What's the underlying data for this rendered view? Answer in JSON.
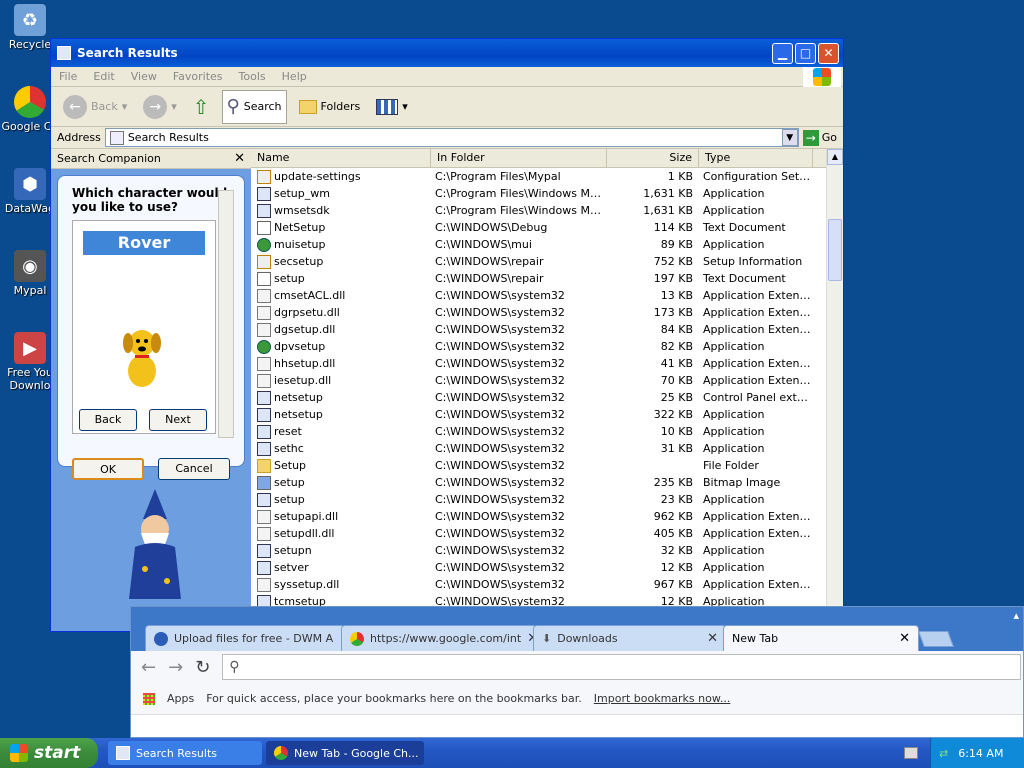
{
  "desktop": {
    "icons": [
      {
        "label": "Recycle",
        "icon": "recycle-bin-icon",
        "color": "#6fa0d8"
      },
      {
        "label": "Google Ch",
        "icon": "chrome-icon",
        "color": "#d33"
      },
      {
        "label": "DataWag",
        "icon": "datawag-icon",
        "color": "#3568b8"
      },
      {
        "label": "Mypal",
        "icon": "mypal-icon",
        "color": "#555"
      },
      {
        "label": "Free You",
        "label2": "Downlo",
        "icon": "freeyoutube-icon",
        "color": "#c44"
      }
    ]
  },
  "explorer": {
    "title": "Search Results",
    "menu": [
      "File",
      "Edit",
      "View",
      "Favorites",
      "Tools",
      "Help"
    ],
    "toolbar": {
      "back": "Back",
      "search": "Search",
      "folders": "Folders"
    },
    "address_label": "Address",
    "address_value": "Search Results",
    "go_label": "Go",
    "companion": {
      "title": "Search Companion",
      "question": "Which character would you like to use?",
      "character": "Rover",
      "back": "Back",
      "next": "Next",
      "ok": "OK",
      "cancel": "Cancel"
    },
    "columns": [
      "Name",
      "In Folder",
      "Size",
      "Type"
    ],
    "rows": [
      {
        "name": "update-settings",
        "folder": "C:\\Program Files\\Mypal",
        "size": "1 KB",
        "type": "Configuration Settings",
        "icon": "gear"
      },
      {
        "name": "setup_wm",
        "folder": "C:\\Program Files\\Windows Medi...",
        "size": "1,631 KB",
        "type": "Application",
        "icon": "app"
      },
      {
        "name": "wmsetsdk",
        "folder": "C:\\Program Files\\Windows Medi...",
        "size": "1,631 KB",
        "type": "Application",
        "icon": "app"
      },
      {
        "name": "NetSetup",
        "folder": "C:\\WINDOWS\\Debug",
        "size": "114 KB",
        "type": "Text Document",
        "icon": "txt"
      },
      {
        "name": "muisetup",
        "folder": "C:\\WINDOWS\\mui",
        "size": "89 KB",
        "type": "Application",
        "icon": "globe"
      },
      {
        "name": "secsetup",
        "folder": "C:\\WINDOWS\\repair",
        "size": "752 KB",
        "type": "Setup Information",
        "icon": "gear"
      },
      {
        "name": "setup",
        "folder": "C:\\WINDOWS\\repair",
        "size": "197 KB",
        "type": "Text Document",
        "icon": "txt"
      },
      {
        "name": "cmsetACL.dll",
        "folder": "C:\\WINDOWS\\system32",
        "size": "13 KB",
        "type": "Application Extension",
        "icon": "dll"
      },
      {
        "name": "dgrpsetu.dll",
        "folder": "C:\\WINDOWS\\system32",
        "size": "173 KB",
        "type": "Application Extension",
        "icon": "dll"
      },
      {
        "name": "dgsetup.dll",
        "folder": "C:\\WINDOWS\\system32",
        "size": "84 KB",
        "type": "Application Extension",
        "icon": "dll"
      },
      {
        "name": "dpvsetup",
        "folder": "C:\\WINDOWS\\system32",
        "size": "82 KB",
        "type": "Application",
        "icon": "globe"
      },
      {
        "name": "hhsetup.dll",
        "folder": "C:\\WINDOWS\\system32",
        "size": "41 KB",
        "type": "Application Extension",
        "icon": "dll"
      },
      {
        "name": "iesetup.dll",
        "folder": "C:\\WINDOWS\\system32",
        "size": "70 KB",
        "type": "Application Extension",
        "icon": "dll"
      },
      {
        "name": "netsetup",
        "folder": "C:\\WINDOWS\\system32",
        "size": "25 KB",
        "type": "Control Panel exten...",
        "icon": "app"
      },
      {
        "name": "netsetup",
        "folder": "C:\\WINDOWS\\system32",
        "size": "322 KB",
        "type": "Application",
        "icon": "app"
      },
      {
        "name": "reset",
        "folder": "C:\\WINDOWS\\system32",
        "size": "10 KB",
        "type": "Application",
        "icon": "app"
      },
      {
        "name": "sethc",
        "folder": "C:\\WINDOWS\\system32",
        "size": "31 KB",
        "type": "Application",
        "icon": "app"
      },
      {
        "name": "Setup",
        "folder": "C:\\WINDOWS\\system32",
        "size": "",
        "type": "File Folder",
        "icon": "folder"
      },
      {
        "name": "setup",
        "folder": "C:\\WINDOWS\\system32",
        "size": "235 KB",
        "type": "Bitmap Image",
        "icon": "img"
      },
      {
        "name": "setup",
        "folder": "C:\\WINDOWS\\system32",
        "size": "23 KB",
        "type": "Application",
        "icon": "app"
      },
      {
        "name": "setupapi.dll",
        "folder": "C:\\WINDOWS\\system32",
        "size": "962 KB",
        "type": "Application Extension",
        "icon": "dll"
      },
      {
        "name": "setupdll.dll",
        "folder": "C:\\WINDOWS\\system32",
        "size": "405 KB",
        "type": "Application Extension",
        "icon": "dll"
      },
      {
        "name": "setupn",
        "folder": "C:\\WINDOWS\\system32",
        "size": "32 KB",
        "type": "Application",
        "icon": "app"
      },
      {
        "name": "setver",
        "folder": "C:\\WINDOWS\\system32",
        "size": "12 KB",
        "type": "Application",
        "icon": "app"
      },
      {
        "name": "syssetup.dll",
        "folder": "C:\\WINDOWS\\system32",
        "size": "967 KB",
        "type": "Application Extension",
        "icon": "dll"
      },
      {
        "name": "tcmsetup",
        "folder": "C:\\WINDOWS\\system32",
        "size": "12 KB",
        "type": "Application",
        "icon": "app"
      }
    ]
  },
  "chrome": {
    "tabs": [
      {
        "label": "Upload files for free - DWM A",
        "icon_color": "#2a5cb8"
      },
      {
        "label": "https://www.google.com/int",
        "icon_color": "#d33"
      },
      {
        "label": "Downloads",
        "icon_color": "#777"
      },
      {
        "label": "New Tab",
        "icon_color": ""
      }
    ],
    "apps_label": "Apps",
    "bookmark_hint": "For quick access, place your bookmarks here on the bookmarks bar.",
    "import_link": "Import bookmarks now..."
  },
  "taskbar": {
    "start": "start",
    "items": [
      {
        "label": "Search Results"
      },
      {
        "label": "New Tab - Google Ch..."
      }
    ],
    "clock": "6:14 AM"
  }
}
